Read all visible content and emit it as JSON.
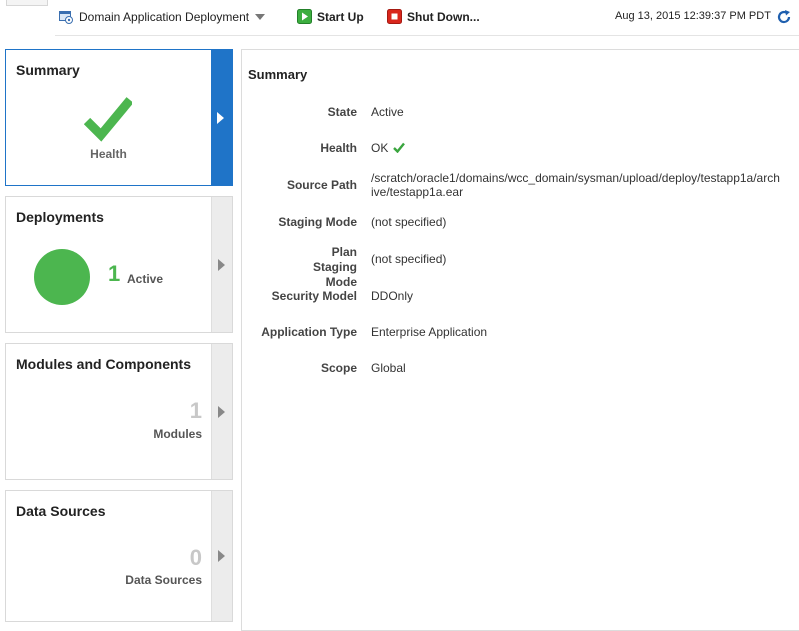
{
  "toolbar": {
    "menu_label": "Domain Application Deployment",
    "start_label": "Start Up",
    "shutdown_label": "Shut Down...",
    "timestamp": "Aug 13, 2015 12:39:37 PM PDT"
  },
  "tiles": {
    "summary": {
      "title": "Summary",
      "health_label": "Health"
    },
    "deployments": {
      "title": "Deployments",
      "count": "1",
      "count_label": "Active"
    },
    "modules": {
      "title": "Modules and Components",
      "count": "1",
      "count_label": "Modules"
    },
    "data_sources": {
      "title": "Data Sources",
      "count": "0",
      "count_label": "Data Sources"
    }
  },
  "summary_panel": {
    "title": "Summary",
    "rows": [
      {
        "label": "State",
        "value": "Active"
      },
      {
        "label": "Health",
        "value": "OK"
      },
      {
        "label": "Source Path",
        "value": "/scratch/oracle1/domains/wcc_domain/sysman/upload/deploy/testapp1a/archive/testapp1a.ear"
      },
      {
        "label": "Staging Mode",
        "value": "(not specified)"
      },
      {
        "label": "Plan Staging Mode",
        "value": "(not specified)"
      },
      {
        "label": "Security Model",
        "value": "DDOnly"
      },
      {
        "label": "Application Type",
        "value": "Enterprise Application"
      },
      {
        "label": "Scope",
        "value": "Global"
      }
    ]
  },
  "icons": {
    "menu": "application-icon",
    "start": "start-icon",
    "shutdown": "stop-icon",
    "refresh": "refresh-icon",
    "health": "check-icon"
  },
  "colors": {
    "accent": "#1f74c8",
    "status_green": "#4cb64f",
    "stop_red": "#d9261c"
  }
}
